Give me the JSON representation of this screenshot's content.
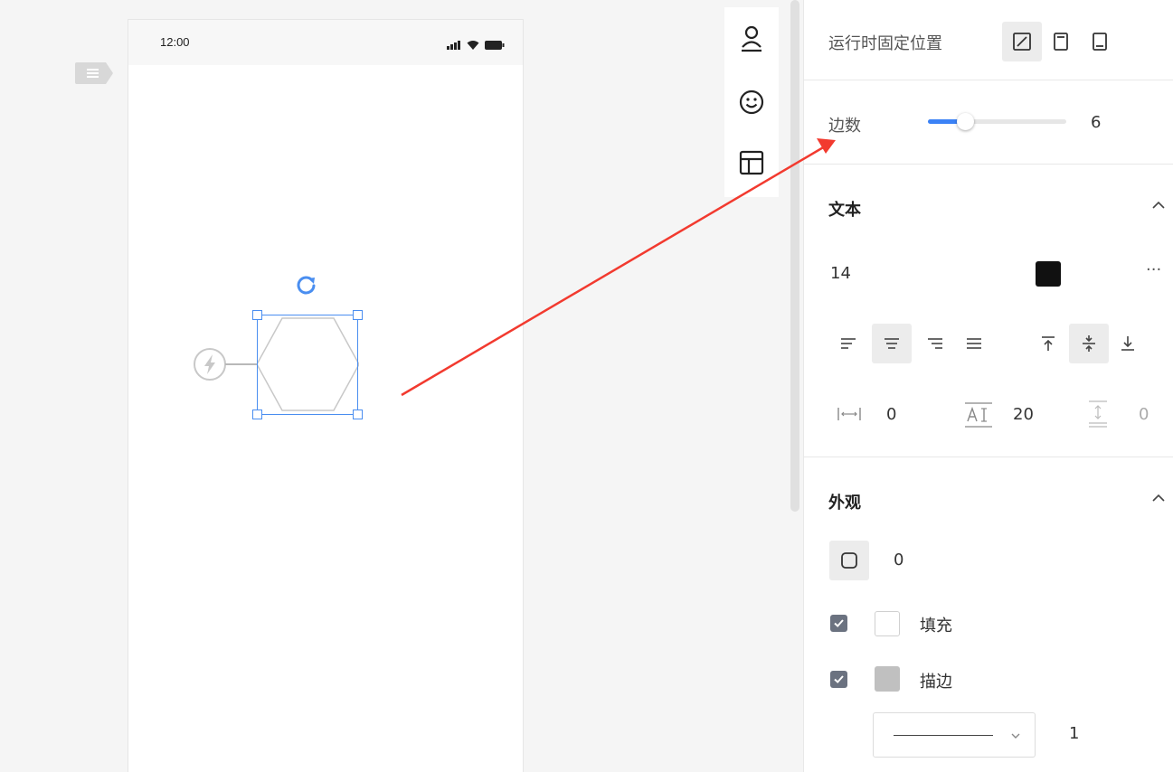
{
  "phone": {
    "time": "12:00"
  },
  "panel": {
    "fixed_position_label": "运行时固定位置",
    "sides_label": "边数",
    "sides_value": "6",
    "sides_slider_fraction": 0.2,
    "text_section": {
      "title": "文本",
      "font_size": "14",
      "font_color": "#111111",
      "more": "···",
      "letter_spacing": "0",
      "line_height": "20",
      "paragraph_spacing": "0"
    },
    "appearance_section": {
      "title": "外观",
      "corner_radius": "0",
      "fill_label": "填充",
      "fill_color": "#ffffff",
      "stroke_label": "描边",
      "stroke_color": "#c0c0c0",
      "stroke_width": "1"
    }
  },
  "colors": {
    "accent": "#4a8ef0",
    "arrow": "#f23a2f"
  }
}
